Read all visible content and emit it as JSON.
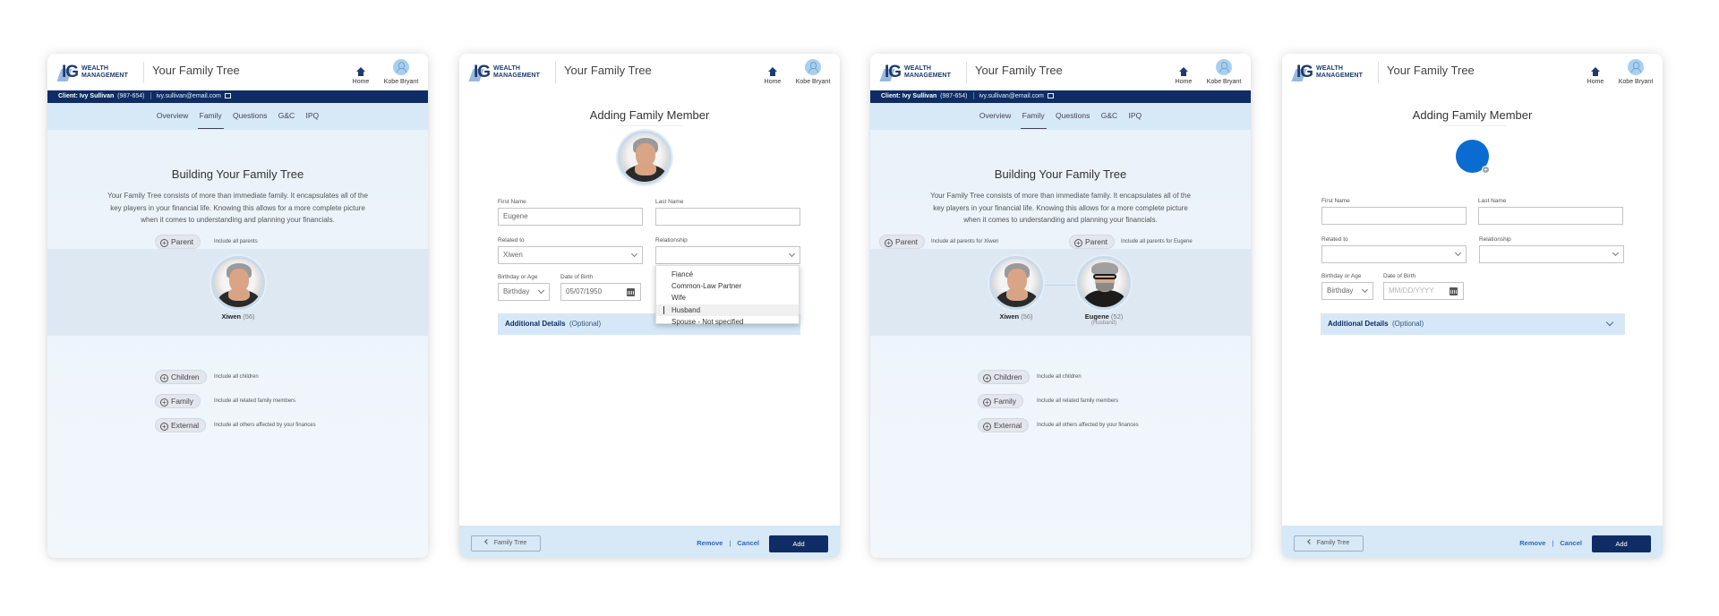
{
  "app": {
    "logo_line1": "WEALTH",
    "logo_line2": "MANAGEMENT",
    "logo_mark": "IG",
    "title": "Your Family Tree",
    "home_label": "Home",
    "user_name": "Kobe Bryant",
    "icons": {
      "home": "home-icon",
      "user": "user-avatar-icon",
      "edit": "edit-icon"
    }
  },
  "client": {
    "label": "Client: Ivy Sullivan",
    "id": "(987-654)",
    "email": "ivy.sullivan@email.com"
  },
  "nav": {
    "tabs": [
      {
        "label": "Overview"
      },
      {
        "label": "Family",
        "active": true
      },
      {
        "label": "Questions"
      },
      {
        "label": "G&C"
      },
      {
        "label": "IPQ"
      }
    ]
  },
  "tree": {
    "heading": "Building Your Family Tree",
    "intro": "Your Family Tree consists of more than immediate family. It encapsulates all of the key players in your financial life. Knowing this allows for a more complete picture when it comes to understanding and planning your financials.",
    "parent_label": "Parent",
    "parent_hint": "Include all parents",
    "parent_hint_xiwen": "Include all parents for Xiwen",
    "parent_hint_eugene": "Include all parents for Eugene",
    "members": [
      {
        "name": "Xiwen",
        "age": "(56)",
        "relation": ""
      },
      {
        "name": "Eugene",
        "age": "(52)",
        "relation": "(Husband)"
      }
    ],
    "actions": [
      {
        "label": "Children",
        "hint": "Include all children"
      },
      {
        "label": "Family",
        "hint": "Include all related family members"
      },
      {
        "label": "External",
        "hint": "Include all others affected by your finances"
      }
    ]
  },
  "form": {
    "title": "Adding Family Member",
    "first_name_label": "First Name",
    "last_name_label": "Last Name",
    "related_to_label": "Related to",
    "relationship_label": "Relationship",
    "birthday_or_age_label": "Birthday or Age",
    "dob_label": "Date of Birth",
    "dob_placeholder": "MM/DD/YYYY",
    "additional_details": "Additional Details",
    "optional": "(Optional)",
    "filled": {
      "first_name": "Eugene",
      "last_name": "",
      "related_to": "Xiwen",
      "relationship": "",
      "birthday_or_age": "Birthday",
      "dob": "05/07/1950"
    },
    "empty": {
      "first_name": "",
      "last_name": "",
      "related_to": "",
      "relationship": "",
      "birthday_or_age": "Birthday",
      "dob": ""
    },
    "relationship_options": [
      {
        "label": "Fiancé"
      },
      {
        "label": "Common-Law Partner"
      },
      {
        "label": "Wife"
      },
      {
        "label": "Husband",
        "hovered": true
      },
      {
        "label": "Spouse - Not specified"
      }
    ]
  },
  "footer": {
    "back_label": "Family Tree",
    "remove_label": "Remove",
    "separator": "|",
    "cancel_label": "Cancel",
    "add_label": "Add"
  },
  "colors": {
    "brand_navy": "#0f2d64",
    "nav_bg": "#d7e8f6",
    "link_blue": "#2a69b8",
    "avatar_blue": "#0a6cd0"
  }
}
